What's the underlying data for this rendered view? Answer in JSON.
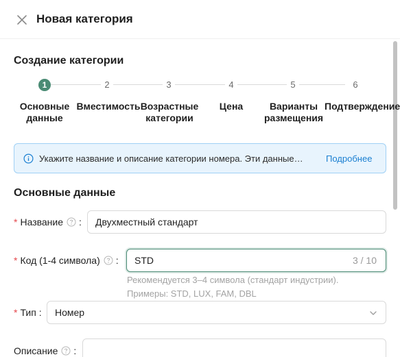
{
  "header": {
    "title": "Новая категория",
    "close_icon": "close-icon"
  },
  "wizard": {
    "title": "Создание категории",
    "steps": [
      {
        "number": "1",
        "label": "Основные\nданные",
        "active": true
      },
      {
        "number": "2",
        "label": "Вместимость",
        "active": false
      },
      {
        "number": "3",
        "label": "Возрастные\nкатегории",
        "active": false
      },
      {
        "number": "4",
        "label": "Цена",
        "active": false
      },
      {
        "number": "5",
        "label": "Варианты\nразмещения",
        "active": false
      },
      {
        "number": "6",
        "label": "Подтверждение",
        "active": false
      }
    ]
  },
  "info": {
    "text": "Укажите название и описание категории номера. Эти данные…",
    "link": "Подробнее"
  },
  "form": {
    "section_title": "Основные данные",
    "name": {
      "label": "Название",
      "value": "Двухместный стандарт"
    },
    "code": {
      "label": "Код (1-4 символа)",
      "value": "STD",
      "count": "3 / 10",
      "hint_line1": "Рекомендуется 3–4 символа (стандарт индустрии).",
      "hint_line2": "Примеры: STD, LUX, FAM, DBL"
    },
    "type": {
      "label": "Тип",
      "value": "Номер"
    },
    "description": {
      "label": "Описание",
      "value": ""
    },
    "colon": ":",
    "required_mark": "*"
  },
  "colors": {
    "accent": "#4a8b74",
    "info_bg": "#e8f4fd",
    "link": "#1a7fd1",
    "required": "#e5484d"
  }
}
